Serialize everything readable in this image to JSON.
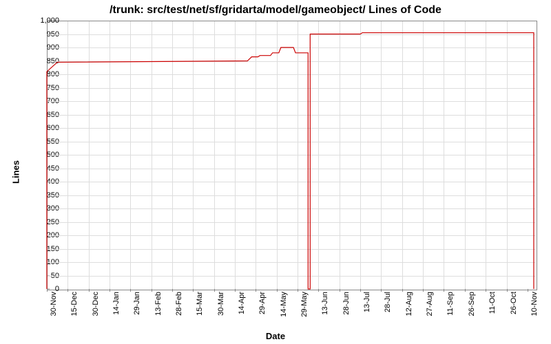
{
  "chart_data": {
    "type": "line",
    "title": "/trunk: src/test/net/sf/gridarta/model/gameobject/ Lines of Code",
    "xlabel": "Date",
    "ylabel": "Lines",
    "ylim": [
      0,
      1000
    ],
    "y_ticks": [
      0,
      50,
      100,
      150,
      200,
      250,
      300,
      350,
      400,
      450,
      500,
      550,
      600,
      650,
      700,
      750,
      800,
      850,
      900,
      950,
      1000
    ],
    "x_categories": [
      "30-Nov",
      "15-Dec",
      "30-Dec",
      "14-Jan",
      "29-Jan",
      "13-Feb",
      "28-Feb",
      "15-Mar",
      "30-Mar",
      "14-Apr",
      "29-Apr",
      "14-May",
      "29-May",
      "13-Jun",
      "28-Jun",
      "13-Jul",
      "28-Jul",
      "12-Aug",
      "27-Aug",
      "11-Sep",
      "26-Sep",
      "11-Oct",
      "26-Oct",
      "10-Nov"
    ],
    "series": [
      {
        "name": "Lines of Code",
        "color": "#cc0000",
        "points": [
          {
            "x": 0.0,
            "y": 0
          },
          {
            "x": 0.0,
            "y": 810
          },
          {
            "x": 0.5,
            "y": 845
          },
          {
            "x": 9.6,
            "y": 850
          },
          {
            "x": 9.8,
            "y": 865
          },
          {
            "x": 10.1,
            "y": 865
          },
          {
            "x": 10.2,
            "y": 870
          },
          {
            "x": 10.7,
            "y": 870
          },
          {
            "x": 10.8,
            "y": 880
          },
          {
            "x": 11.1,
            "y": 880
          },
          {
            "x": 11.2,
            "y": 900
          },
          {
            "x": 11.8,
            "y": 900
          },
          {
            "x": 11.9,
            "y": 880
          },
          {
            "x": 12.5,
            "y": 880
          },
          {
            "x": 12.5,
            "y": 0
          },
          {
            "x": 12.6,
            "y": 0
          },
          {
            "x": 12.6,
            "y": 950
          },
          {
            "x": 15.0,
            "y": 950
          },
          {
            "x": 15.1,
            "y": 955
          },
          {
            "x": 23.3,
            "y": 955
          },
          {
            "x": 23.3,
            "y": 0
          }
        ]
      }
    ]
  }
}
